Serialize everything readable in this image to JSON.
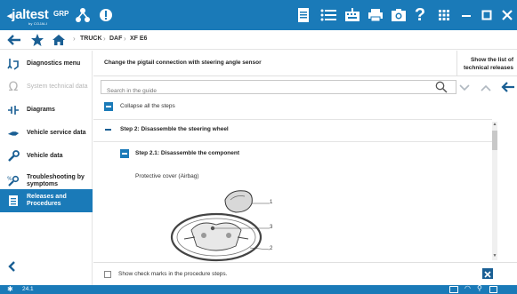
{
  "app": {
    "logo": "jaltest",
    "logo_sub": "by COJALI",
    "group_label": "GRP"
  },
  "breadcrumb": {
    "items": [
      "TRUCK",
      "DAF",
      "XF E6"
    ]
  },
  "sidebar": {
    "items": [
      {
        "label": "Diagnostics menu",
        "icon": "diagnostics-icon",
        "state": "normal"
      },
      {
        "label": "System technical data",
        "icon": "ohm-icon",
        "state": "disabled"
      },
      {
        "label": "Diagrams",
        "icon": "diagram-icon",
        "state": "normal"
      },
      {
        "label": "Vehicle service data",
        "icon": "service-icon",
        "state": "normal"
      },
      {
        "label": "Vehicle data",
        "icon": "wrench-icon",
        "state": "normal"
      },
      {
        "label": "Troubleshooting by symptoms",
        "icon": "troubleshooting-icon",
        "state": "normal"
      },
      {
        "label": "Releases and Procedures",
        "icon": "procedures-icon",
        "state": "active"
      }
    ]
  },
  "main": {
    "title": "Change the pigtail connection with steering angle sensor",
    "show_list_label": "Show the list of technical releases",
    "search_placeholder": "Search in the guide",
    "collapse_label": "Collapse all the steps",
    "step_title": "Step 2: Disassemble the steering wheel",
    "substep_title": "Step 2.1: Disassemble the component",
    "caption": "Protective cover (Airbag)",
    "callouts": [
      "1",
      "3",
      "2"
    ],
    "checkmark_label": "Show check marks in the procedure steps."
  },
  "status": {
    "version": "24.1"
  },
  "colors": {
    "primary": "#1a7ab8",
    "text": "#222222"
  }
}
